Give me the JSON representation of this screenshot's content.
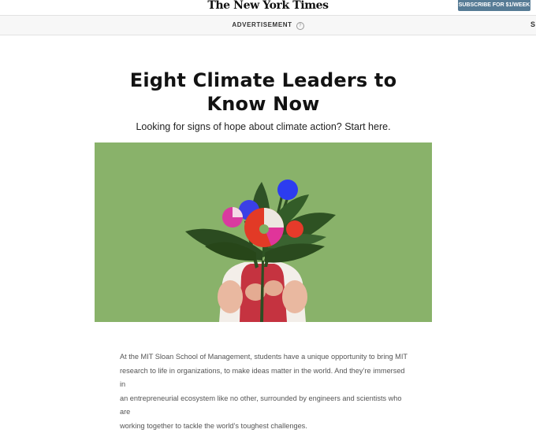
{
  "header": {
    "logo": "The New York Times",
    "subscribe_label": "SUBSCRIBE FOR $1/WEEK"
  },
  "ad_bar": {
    "label": "ADVERTISEMENT",
    "info_icon": "?",
    "edge_text": "S"
  },
  "article": {
    "headline_line1": "Eight Climate Leaders to",
    "headline_line2": "Know Now",
    "dek": "Looking for signs of hope about climate action? Start here.",
    "image": {
      "background_color": "#89b26a",
      "description_icon": "child-holding-bouquet-illustration"
    },
    "body_lines": [
      "At the MIT Sloan School of Management, students have a unique opportunity to bring MIT",
      "research to life in organizations, to make ideas matter in the world. And they’re immersed in",
      "an entrepreneurial ecosystem like no other, surrounded by engineers and scientists who are",
      "working together to tackle the world’s toughest challenges."
    ]
  }
}
